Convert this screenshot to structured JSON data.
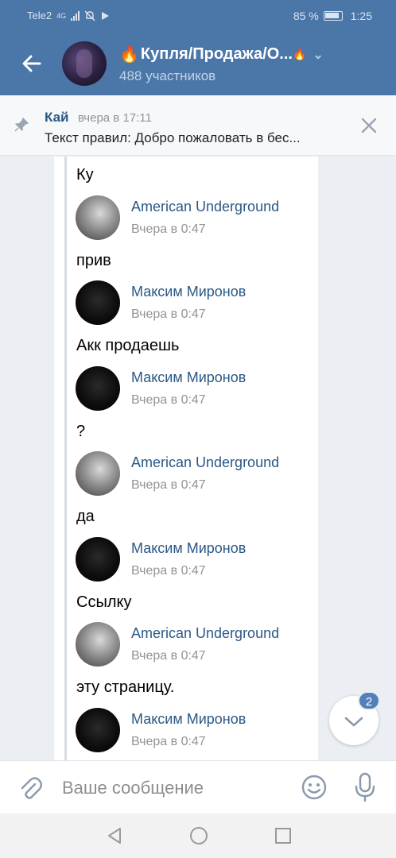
{
  "status_bar": {
    "carrier": "Tele2",
    "network": "4G",
    "battery": "85 %",
    "time": "1:25"
  },
  "header": {
    "title": "Купля/Продажа/О...",
    "members": "488 участников"
  },
  "pinned": {
    "author": "Кай",
    "time": "вчера в 17:11",
    "text": "Текст правил: Добро пожаловать в бес..."
  },
  "messages": [
    {
      "text": "Ку",
      "fwd_name": "American Underground",
      "fwd_time": "Вчера в 0:47",
      "avatar": "gray"
    },
    {
      "text": "прив",
      "fwd_name": "Максим Миронов",
      "fwd_time": "Вчера в 0:47",
      "avatar": "dark"
    },
    {
      "text": "Акк продаешь",
      "fwd_name": "Максим Миронов",
      "fwd_time": "Вчера в 0:47",
      "avatar": "dark"
    },
    {
      "text": "?",
      "fwd_name": "American Underground",
      "fwd_time": "Вчера в 0:47",
      "avatar": "gray"
    },
    {
      "text": "да",
      "fwd_name": "Максим Миронов",
      "fwd_time": "Вчера в 0:47",
      "avatar": "dark"
    },
    {
      "text": "Ссылку",
      "fwd_name": "American Underground",
      "fwd_time": "Вчера в 0:47",
      "avatar": "gray"
    },
    {
      "text": "эту страницу.",
      "fwd_name": "Максим Миронов",
      "fwd_time": "Вчера в 0:47",
      "avatar": "dark"
    }
  ],
  "scroll_badge": "2",
  "composer": {
    "placeholder": "Ваше сообщение"
  },
  "colors": {
    "header": "#4a76a8",
    "link": "#2a5885",
    "muted": "#939393"
  }
}
